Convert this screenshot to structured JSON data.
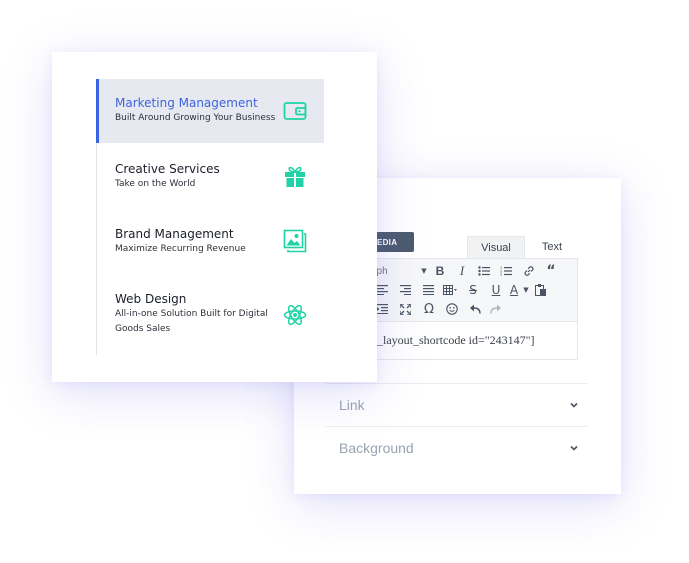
{
  "services": {
    "items": [
      {
        "title": "Marketing Management",
        "subtitle": "Built Around Growing Your Business",
        "icon": "wallet-icon",
        "active": true
      },
      {
        "title": "Creative Services",
        "subtitle": "Take on the World",
        "icon": "gift-icon",
        "active": false
      },
      {
        "title": "Brand Management",
        "subtitle": "Maximize Recurring Revenue",
        "icon": "image-gallery-icon",
        "active": false
      },
      {
        "title": "Web Design",
        "subtitle": "All-in-one Solution Built for Digital Goods Sales",
        "icon": "atom-icon",
        "active": false
      }
    ],
    "accent": "#3f63db",
    "icon_color": "#1fd3a6"
  },
  "editor": {
    "media_label": "MEDIA",
    "tabs": {
      "visual": "Visual",
      "text": "Text"
    },
    "format_select": "aph",
    "content": "_layout_shortcode id=\"243147\"]",
    "sections": [
      "Link",
      "Background"
    ]
  }
}
